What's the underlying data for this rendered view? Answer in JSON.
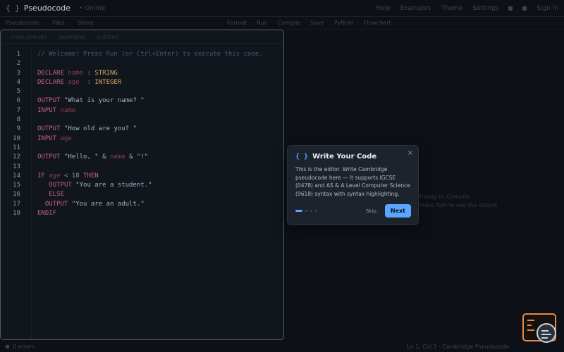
{
  "app": {
    "brand_icon": "{ }",
    "title": "Pseudocode",
    "subtitle": "• Online",
    "nav": [
      "Help",
      "Examples",
      "Theme",
      "Settings"
    ],
    "nav_right": "Sign in"
  },
  "toolbar": {
    "left": [
      "Pseudocode",
      "Files",
      "Share"
    ],
    "right": [
      "Format",
      "Run",
      "Compile",
      "Save",
      "Python",
      "Flowchart"
    ]
  },
  "editor": {
    "tabs": [
      "main.pseudo",
      "examples",
      "untitled"
    ],
    "lines": [
      {
        "n": "1",
        "segments": [
          {
            "t": "cm",
            "v": "// Welcome! Press Run (or Ctrl+Enter) to execute this code."
          }
        ]
      },
      {
        "n": "2",
        "segments": []
      },
      {
        "n": "3",
        "segments": [
          {
            "t": "kw",
            "v": "DECLARE "
          },
          {
            "t": "id",
            "v": "name"
          },
          {
            "t": "plain",
            "v": " : "
          },
          {
            "t": "ty",
            "v": "STRING"
          }
        ]
      },
      {
        "n": "4",
        "segments": [
          {
            "t": "kw",
            "v": "DECLARE "
          },
          {
            "t": "id",
            "v": "age"
          },
          {
            "t": "plain",
            "v": "  : "
          },
          {
            "t": "ty",
            "v": "INTEGER"
          }
        ]
      },
      {
        "n": "5",
        "segments": []
      },
      {
        "n": "6",
        "segments": [
          {
            "t": "kw",
            "v": "OUTPUT "
          },
          {
            "t": "str",
            "v": "\"What is your name? \""
          }
        ]
      },
      {
        "n": "7",
        "segments": [
          {
            "t": "kw",
            "v": "INPUT "
          },
          {
            "t": "id",
            "v": "name"
          }
        ]
      },
      {
        "n": "8",
        "segments": []
      },
      {
        "n": "9",
        "segments": [
          {
            "t": "kw",
            "v": "OUTPUT "
          },
          {
            "t": "str",
            "v": "\"How old are you? \""
          }
        ]
      },
      {
        "n": "10",
        "segments": [
          {
            "t": "kw",
            "v": "INPUT "
          },
          {
            "t": "id",
            "v": "age"
          }
        ]
      },
      {
        "n": "11",
        "segments": []
      },
      {
        "n": "12",
        "segments": [
          {
            "t": "kw",
            "v": "OUTPUT "
          },
          {
            "t": "str",
            "v": "\"Hello, \" & "
          },
          {
            "t": "id",
            "v": "name"
          },
          {
            "t": "str",
            "v": " & \"!\""
          }
        ]
      },
      {
        "n": "13",
        "segments": []
      },
      {
        "n": "14",
        "segments": [
          {
            "t": "kw",
            "v": "IF "
          },
          {
            "t": "id",
            "v": "age"
          },
          {
            "t": "plain",
            "v": " < 18 "
          },
          {
            "t": "kw",
            "v": "THEN"
          }
        ]
      },
      {
        "n": "15",
        "segments": [
          {
            "t": "plain",
            "v": "   "
          },
          {
            "t": "kw",
            "v": "OUTPUT "
          },
          {
            "t": "str",
            "v": "\"You are a student.\""
          }
        ]
      },
      {
        "n": "16",
        "segments": [
          {
            "t": "plain",
            "v": "   "
          },
          {
            "t": "kw",
            "v": "ELSE"
          }
        ]
      },
      {
        "n": "17",
        "segments": [
          {
            "t": "plain",
            "v": "  "
          },
          {
            "t": "kw",
            "v": "OUTPUT "
          },
          {
            "t": "str",
            "v": "\"You are an adult.\""
          }
        ]
      },
      {
        "n": "18",
        "segments": [
          {
            "t": "kw",
            "v": "ENDIF"
          }
        ]
      }
    ]
  },
  "right_pane": {
    "line1": "Ready to Compile",
    "line2": "Press Run to see the output"
  },
  "tour": {
    "icon": "{ }",
    "title": "Write Your Code",
    "description": "This is the editor. Write Cambridge pseudocode here — it supports IGCSE (0478) and AS & A Level Computer Science (9618) syntax with syntax highlighting.",
    "step": 1,
    "total_steps": 4,
    "skip_label": "Skip",
    "next_label": "Next",
    "close_glyph": "×"
  },
  "status": {
    "left": "0 errors",
    "right": "Ln 1, Col 1  ·  Cambridge Pseudocode"
  },
  "colors": {
    "accent": "#58a6ff",
    "helper_border": "#e8874a",
    "background": "#0d1117"
  }
}
